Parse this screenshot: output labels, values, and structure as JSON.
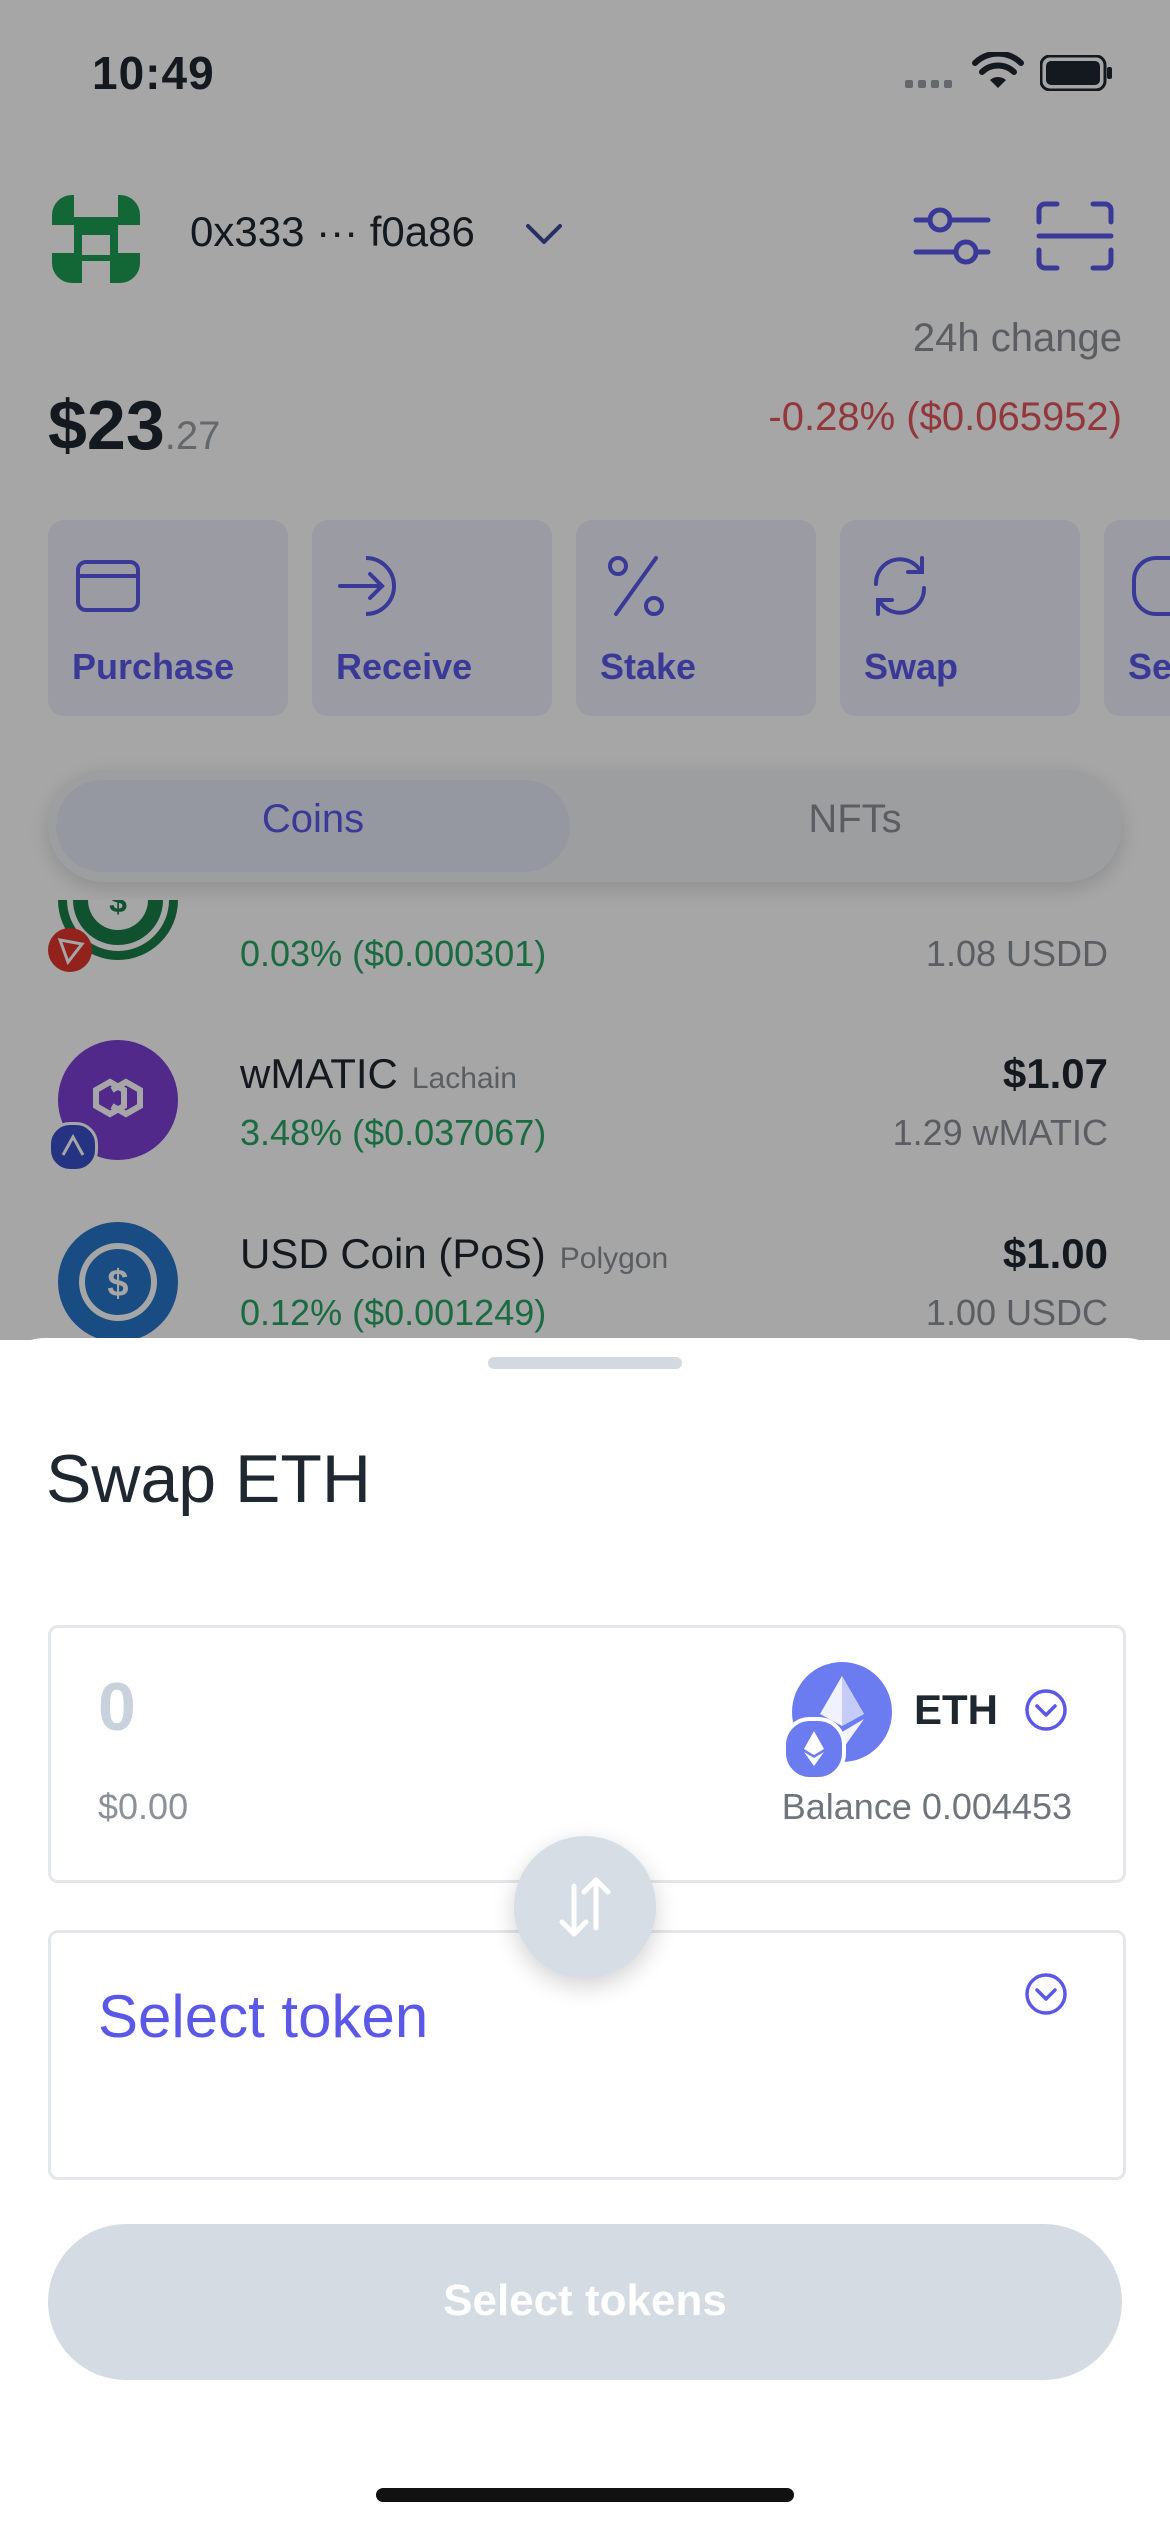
{
  "status_bar": {
    "time": "10:49"
  },
  "header": {
    "wallet_address": "0x333 ··· f0a86",
    "change_label": "24h change",
    "change_value": "-0.28% ($0.065952)",
    "balance_main": "$23",
    "balance_cents": ".27"
  },
  "actions": [
    {
      "label": "Purchase",
      "icon": "card-icon"
    },
    {
      "label": "Receive",
      "icon": "receive-icon"
    },
    {
      "label": "Stake",
      "icon": "percent-icon"
    },
    {
      "label": "Swap",
      "icon": "swap-icon"
    },
    {
      "label": "Se",
      "icon": "send-icon"
    }
  ],
  "tabs": {
    "coins": "Coins",
    "nfts": "NFTs"
  },
  "assets": [
    {
      "name": "",
      "chain": "",
      "change": "0.03% ($0.000301)",
      "value": "",
      "amount": "1.08 USDD"
    },
    {
      "name": "wMATIC",
      "chain": "Lachain",
      "change": "3.48% ($0.037067)",
      "value": "$1.07",
      "amount": "1.29 wMATIC"
    },
    {
      "name": "USD Coin (PoS)",
      "chain": "Polygon",
      "change": "0.12% ($0.001249)",
      "value": "$1.00",
      "amount": "1.00 USDC"
    }
  ],
  "sheet": {
    "title": "Swap ETH",
    "from": {
      "amount": "0",
      "fiat": "$0.00",
      "token": "ETH",
      "balance": "Balance 0.004453"
    },
    "to": {
      "placeholder": "Select token"
    },
    "cta": "Select tokens"
  },
  "colors": {
    "accent": "#5b58e8",
    "negative": "#e1555d",
    "positive": "#28a565"
  }
}
